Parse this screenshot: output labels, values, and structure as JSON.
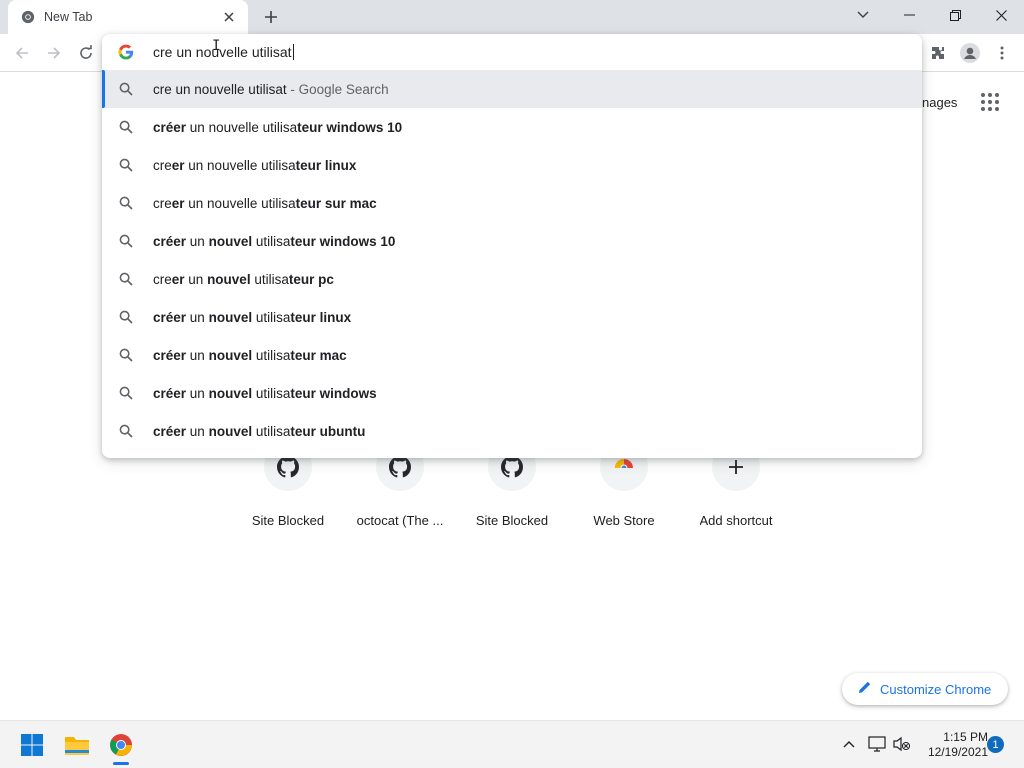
{
  "browser": {
    "tab_title": "New Tab",
    "omnibox_text": "cre un nouvelle utilisat"
  },
  "suggestions": [
    {
      "segments": [
        {
          "t": "cre un nouvelle utilisat",
          "b": false
        }
      ],
      "suffix": " - Google Search",
      "selected": true
    },
    {
      "segments": [
        {
          "t": "créer",
          "b": true
        },
        {
          "t": " un nouvelle utilisa",
          "b": false
        },
        {
          "t": "teur windows 10",
          "b": true
        }
      ]
    },
    {
      "segments": [
        {
          "t": "cre",
          "b": false
        },
        {
          "t": "er",
          "b": true
        },
        {
          "t": " un nouvelle utilisa",
          "b": false
        },
        {
          "t": "teur linux",
          "b": true
        }
      ]
    },
    {
      "segments": [
        {
          "t": "cre",
          "b": false
        },
        {
          "t": "er",
          "b": true
        },
        {
          "t": " un nouvelle utilisa",
          "b": false
        },
        {
          "t": "teur sur mac",
          "b": true
        }
      ]
    },
    {
      "segments": [
        {
          "t": "créer",
          "b": true
        },
        {
          "t": " un ",
          "b": false
        },
        {
          "t": "nouvel",
          "b": true
        },
        {
          "t": " utilisa",
          "b": false
        },
        {
          "t": "teur windows 10",
          "b": true
        }
      ]
    },
    {
      "segments": [
        {
          "t": "cre",
          "b": false
        },
        {
          "t": "er",
          "b": true
        },
        {
          "t": " un ",
          "b": false
        },
        {
          "t": "nouvel",
          "b": true
        },
        {
          "t": " utilisa",
          "b": false
        },
        {
          "t": "teur pc",
          "b": true
        }
      ]
    },
    {
      "segments": [
        {
          "t": "créer",
          "b": true
        },
        {
          "t": " un ",
          "b": false
        },
        {
          "t": "nouvel",
          "b": true
        },
        {
          "t": " utilisa",
          "b": false
        },
        {
          "t": "teur linux",
          "b": true
        }
      ]
    },
    {
      "segments": [
        {
          "t": "créer",
          "b": true
        },
        {
          "t": " un ",
          "b": false
        },
        {
          "t": "nouvel",
          "b": true
        },
        {
          "t": " utilisa",
          "b": false
        },
        {
          "t": "teur mac",
          "b": true
        }
      ]
    },
    {
      "segments": [
        {
          "t": "créer",
          "b": true
        },
        {
          "t": " un ",
          "b": false
        },
        {
          "t": "nouvel",
          "b": true
        },
        {
          "t": " utilisa",
          "b": false
        },
        {
          "t": "teur windows",
          "b": true
        }
      ]
    },
    {
      "segments": [
        {
          "t": "créer",
          "b": true
        },
        {
          "t": " un ",
          "b": false
        },
        {
          "t": "nouvel",
          "b": true
        },
        {
          "t": " utilisa",
          "b": false
        },
        {
          "t": "teur ubuntu",
          "b": true
        }
      ]
    }
  ],
  "ntp": {
    "images_link": "nages",
    "shortcuts": [
      {
        "label": "Site Blocked",
        "icon": "github-icon"
      },
      {
        "label": "octocat (The ...",
        "icon": "github-icon"
      },
      {
        "label": "Site Blocked",
        "icon": "github-icon"
      },
      {
        "label": "Web Store",
        "icon": "chrome-webstore-icon"
      },
      {
        "label": "Add shortcut",
        "icon": "plus-icon"
      }
    ],
    "customize_label": "Customize Chrome"
  },
  "taskbar": {
    "time": "1:15 PM",
    "date": "12/19/2021",
    "notification_count": "1"
  },
  "colors": {
    "accent": "#1a73e8",
    "tabstrip": "#dee1e6",
    "selected_row": "#e8eaed"
  }
}
